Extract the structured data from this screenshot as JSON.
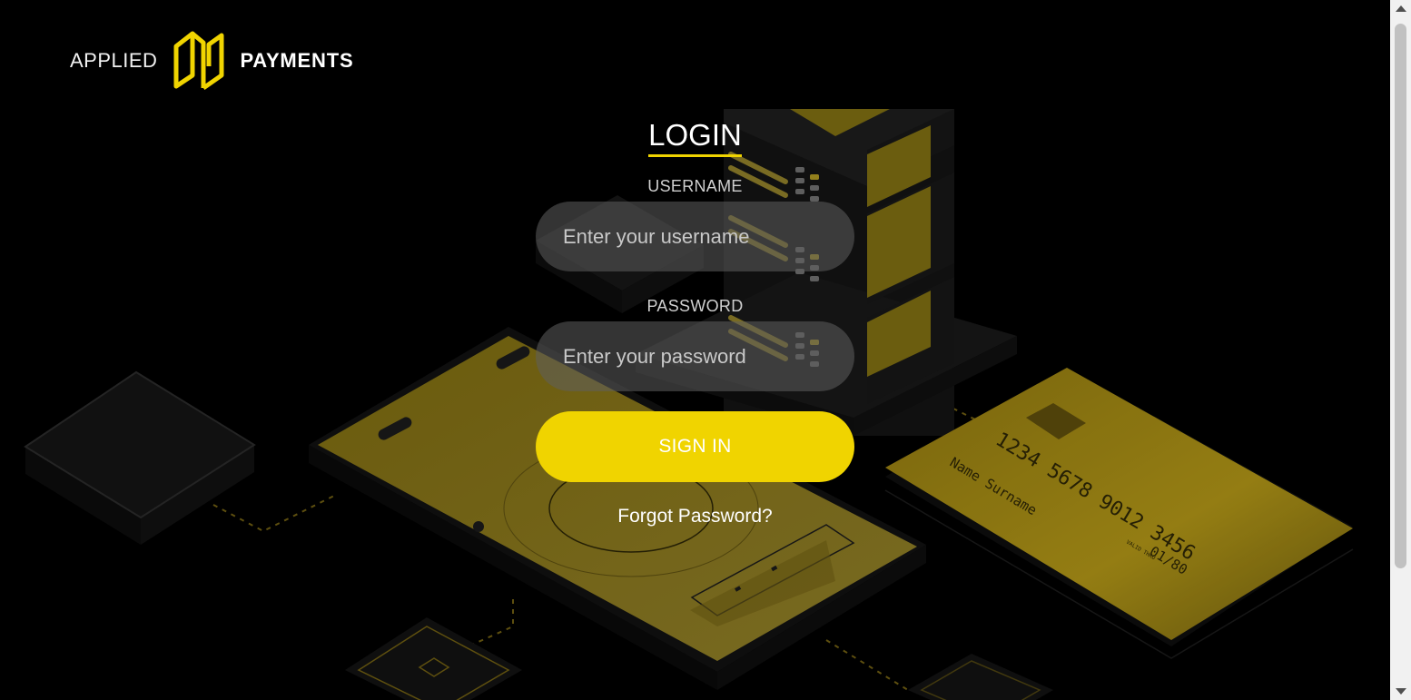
{
  "brand": {
    "left_text": "APPLIED",
    "right_text": "PAYMENTS",
    "mark_icon": "applied-payments-logo-icon",
    "accent_color": "#f0d400"
  },
  "login": {
    "title": "LOGIN",
    "username_label": "USERNAME",
    "username_placeholder": "Enter your username",
    "username_value": "",
    "password_label": "PASSWORD",
    "password_placeholder": "Enter your password",
    "password_value": "",
    "signin_label": "SIGN IN",
    "forgot_label": "Forgot Password?"
  },
  "illustration": {
    "card_number": "1234  5678  9012  3456",
    "card_name": "Name Surname",
    "card_valid_label": "VALID THRU",
    "card_valid_value": "01/80"
  }
}
